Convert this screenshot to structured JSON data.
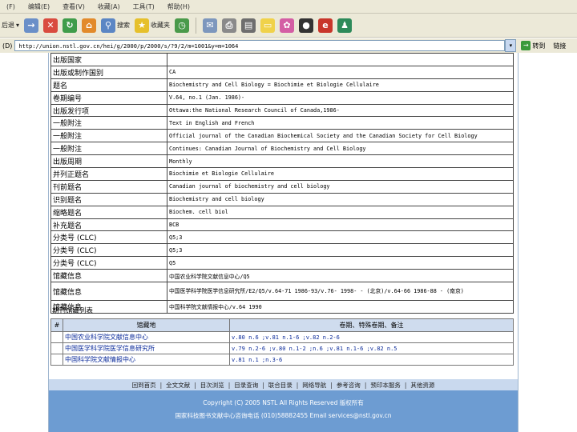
{
  "menu": [
    "(F)",
    "编辑(E)",
    "查看(V)",
    "收藏(A)",
    "工具(T)",
    "帮助(H)"
  ],
  "toolbar": {
    "back_label": "后退",
    "search_label": "搜索",
    "favorites_label": "收藏夹"
  },
  "address": {
    "label": "(D)",
    "url": "http://union.nstl.gov.cn/hei/g/2000/p/2000/s/?9/2/m=1001&y=m=1064",
    "go_label": "转到",
    "links_label": "链接"
  },
  "record": {
    "rows": [
      {
        "key": "出版国家",
        "value": ""
      },
      {
        "key": "出版或制作国别",
        "value": "CA"
      },
      {
        "key": "题名",
        "value": "Biochemistry and Cell Biology = Biochimie et Biologie Cellulaire"
      },
      {
        "key": "卷期编号",
        "value": "V.64, no.1 (Jan. 1986)-"
      },
      {
        "key": "出版发行项",
        "value": "Ottawa:the National Research Council of Canada,1986-"
      },
      {
        "key": "一般附注",
        "value": "Text in English and French"
      },
      {
        "key": "一般附注",
        "value": "Official journal of the Canadian Biochemical Society and the Canadian Society for Cell Biology"
      },
      {
        "key": "一般附注",
        "value": "Continues: Canadian Journal of Biochemistry and Cell Biology"
      },
      {
        "key": "出版周期",
        "value": "Monthly"
      },
      {
        "key": "并列正题名",
        "value": "Biochimie et Biologie Cellulaire"
      },
      {
        "key": "刊前题名",
        "value": "Canadian journal of biochemistry and cell biology"
      },
      {
        "key": "识别题名",
        "value": "Biochemistry and cell biology"
      },
      {
        "key": "缩略题名",
        "value": "Biochem. cell biol"
      },
      {
        "key": "补充题名",
        "value": "BCB"
      },
      {
        "key": "分类号 (CLC)",
        "value": "Q5;3"
      },
      {
        "key": "分类号 (CLC)",
        "value": "Q5;3"
      },
      {
        "key": "分类号 (CLC)",
        "value": "Q5"
      },
      {
        "key": "馆藏信息",
        "value": "中国农业科学院文献信息中心/Q5"
      },
      {
        "key": "馆藏信息",
        "value": "中国医学科学院医学信息研究所/E2/Q5/v.64-71 1986-93/v.76- 1998- - (北京)/v.64-66 1986-88 - (南京)",
        "tall": true
      },
      {
        "key": "馆藏信息",
        "value": "中国科学院文献情报中心/v.64 1990"
      }
    ]
  },
  "holdings": {
    "title": "期刊馆藏列表",
    "headers": [
      "#",
      "馆藏地",
      "卷期、特殊卷期、备注"
    ],
    "rows": [
      {
        "lib": "中国农业科学院文献信息中心",
        "vol": "v.80 n.6 ;v.81 n.1-6 ;v.82 n.2-6"
      },
      {
        "lib": "中国医学科学院医学信息研究所",
        "vol": "v.79 n.2-6 ;v.80 n.1-2 ;n.6 ;v.81 n.1-6 ;v.82 n.5"
      },
      {
        "lib": "中国科学院文献情报中心",
        "vol": "v.81 n.1 ;n.3-6"
      }
    ]
  },
  "footer": {
    "links": [
      "回到首页",
      "全文文献",
      "目次浏览",
      "目录查询",
      "联合目录",
      "网络导航",
      "参考咨询",
      "预印本服务",
      "其他资源"
    ],
    "copyright": "Copyright (C) 2005 NSTL All Rights Reserved 版权所有",
    "contact": "国家科技图书文献中心咨询电话 (010)58882455 Email services@nstl.gov.cn"
  }
}
